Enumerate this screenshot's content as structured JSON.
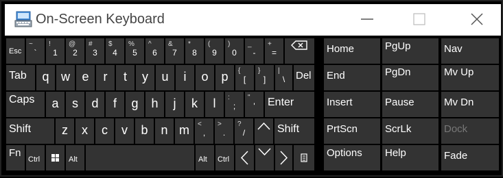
{
  "window": {
    "title": "On-Screen Keyboard",
    "icon": "keyboard-icon"
  },
  "controls": {
    "minimize": "minimize-icon",
    "maximize": "maximize-icon",
    "close": "close-icon"
  },
  "rows": {
    "r1": {
      "esc": "Esc",
      "backtick": {
        "shift": "~",
        "base": "`"
      },
      "n1": {
        "shift": "!",
        "base": "1"
      },
      "n2": {
        "shift": "@",
        "base": "2"
      },
      "n3": {
        "shift": "#",
        "base": "3"
      },
      "n4": {
        "shift": "$",
        "base": "4"
      },
      "n5": {
        "shift": "%",
        "base": "5"
      },
      "n6": {
        "shift": "^",
        "base": "6"
      },
      "n7": {
        "shift": "&",
        "base": "7"
      },
      "n8": {
        "shift": "*",
        "base": "8"
      },
      "n9": {
        "shift": "(",
        "base": "9"
      },
      "n0": {
        "shift": ")",
        "base": "0"
      },
      "minus": {
        "shift": "_",
        "base": "-"
      },
      "equals": {
        "shift": "+",
        "base": "="
      },
      "backspace": "backspace-icon"
    },
    "r2": {
      "tab": "Tab",
      "letters": [
        "q",
        "w",
        "e",
        "r",
        "t",
        "y",
        "u",
        "i",
        "o",
        "p"
      ],
      "lbracket": {
        "shift": "{",
        "base": "["
      },
      "rbracket": {
        "shift": "}",
        "base": "]"
      },
      "backslash": {
        "shift": "|",
        "base": "\\"
      },
      "del": "Del"
    },
    "r3": {
      "caps": "Caps",
      "letters": [
        "a",
        "s",
        "d",
        "f",
        "g",
        "h",
        "j",
        "k",
        "l"
      ],
      "semicolon": {
        "shift": ":",
        "base": ";"
      },
      "quote": {
        "shift": "\"",
        "base": "'"
      },
      "enter": "Enter"
    },
    "r4": {
      "shift_left": "Shift",
      "letters": [
        "z",
        "x",
        "c",
        "v",
        "b",
        "n",
        "m"
      ],
      "comma": {
        "shift": "<",
        "base": ","
      },
      "period": {
        "shift": ">",
        "base": "."
      },
      "slash": {
        "shift": "?",
        "base": "/"
      },
      "up": "arrow-up-icon",
      "shift_right": "Shift"
    },
    "r5": {
      "fn": "Fn",
      "ctrl_left": "Ctrl",
      "win": "windows-icon",
      "alt_left": "Alt",
      "alt_right": "Alt",
      "ctrl_right": "Ctrl",
      "left": "arrow-left-icon",
      "down": "arrow-down-icon",
      "right": "arrow-right-icon",
      "menu": "menu-icon"
    }
  },
  "nav": {
    "home": "Home",
    "pgup": "PgUp",
    "navkey": "Nav",
    "end": "End",
    "pgdn": "PgDn",
    "mvup": "Mv Up",
    "insert": "Insert",
    "pause": "Pause",
    "mvdn": "Mv Dn",
    "prtscn": "PrtScn",
    "scrlk": "ScrLk",
    "dock": "Dock",
    "options": "Options",
    "help": "Help",
    "fade": "Fade"
  },
  "colors": {
    "key": "#333333",
    "background": "#000000",
    "text": "#ffffff",
    "disabled_text": "#777777"
  }
}
